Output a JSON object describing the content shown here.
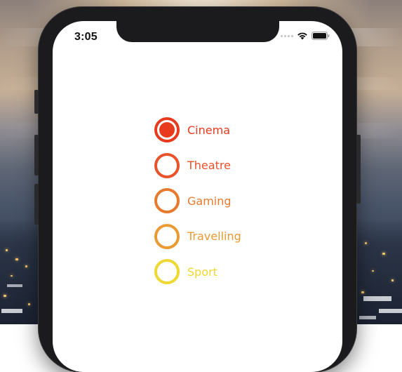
{
  "status_bar": {
    "time": "3:05",
    "icons": [
      "cellular-dots-icon",
      "wifi-icon",
      "battery-icon"
    ]
  },
  "radio_group": {
    "selected": "Cinema",
    "options": [
      {
        "label": "Cinema",
        "color": "#e83a1c",
        "checked": true
      },
      {
        "label": "Theatre",
        "color": "#e8532a",
        "checked": false
      },
      {
        "label": "Gaming",
        "color": "#e87a2e",
        "checked": false
      },
      {
        "label": "Travelling",
        "color": "#ea9a32",
        "checked": false
      },
      {
        "label": "Sport",
        "color": "#eed833",
        "checked": false
      }
    ]
  }
}
